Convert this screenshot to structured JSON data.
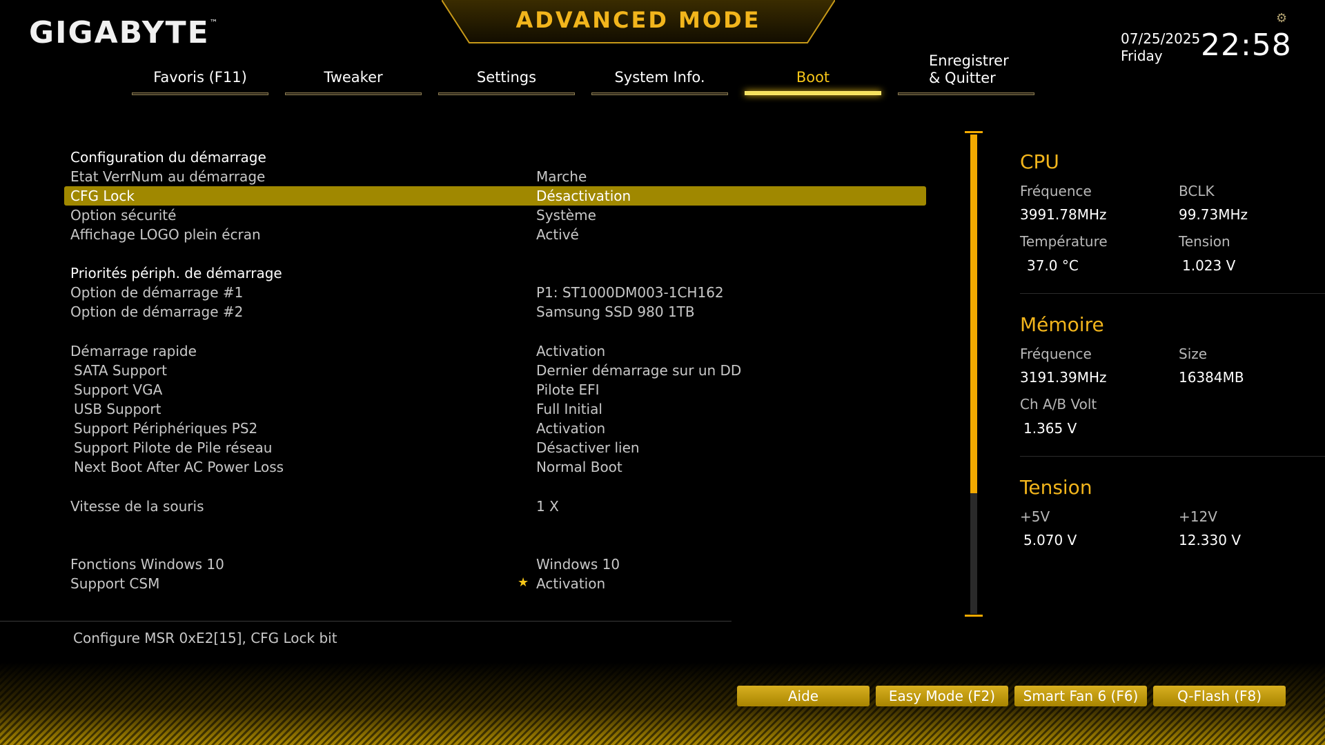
{
  "header": {
    "logo": "GIGABYTE",
    "logo_tm": "™",
    "mode_title": "ADVANCED MODE",
    "date": "07/25/2025",
    "day": "Friday",
    "time": "22:58",
    "settings_icon": "gear-icon"
  },
  "tabs": [
    {
      "label": "Favoris (F11)"
    },
    {
      "label": "Tweaker"
    },
    {
      "label": "Settings"
    },
    {
      "label": "System Info."
    },
    {
      "label": "Boot",
      "active": true
    },
    {
      "label": "Enregistrer\n& Quitter"
    }
  ],
  "sections": {
    "boot_config": "Configuration du démarrage",
    "boot_priority": "Priorités périph. de démarrage"
  },
  "settings": [
    {
      "label": "Etat VerrNum au démarrage",
      "value": "Marche"
    },
    {
      "label": "CFG Lock",
      "value": "Désactivation",
      "selected": true
    },
    {
      "label": "Option sécurité",
      "value": "Système"
    },
    {
      "label": "Affichage LOGO plein écran",
      "value": "Activé"
    },
    {
      "label": "Option de démarrage #1",
      "value": "P1: ST1000DM003-1CH162"
    },
    {
      "label": "Option de démarrage #2",
      "value": "Samsung SSD 980 1TB"
    },
    {
      "label": "Démarrage rapide",
      "value": "Activation"
    },
    {
      "label": "SATA Support",
      "value": "Dernier démarrage sur un DD"
    },
    {
      "label": "Support VGA",
      "value": "Pilote EFI"
    },
    {
      "label": "USB Support",
      "value": "Full Initial"
    },
    {
      "label": "Support Périphériques PS2",
      "value": "Activation"
    },
    {
      "label": "Support Pilote de Pile réseau",
      "value": "Désactiver lien"
    },
    {
      "label": "Next Boot After AC Power Loss",
      "value": "Normal Boot"
    },
    {
      "label": "Vitesse de la souris",
      "value": "1 X"
    },
    {
      "label": "Fonctions Windows 10",
      "value": "Windows 10"
    },
    {
      "label": "Support CSM",
      "value": "Activation",
      "modified_star": "★"
    }
  ],
  "help_text": "Configure MSR 0xE2[15], CFG Lock bit",
  "info": {
    "cpu": {
      "title": "CPU",
      "freq_label": "Fréquence",
      "freq": "3991.78MHz",
      "bclk_label": "BCLK",
      "bclk": "99.73MHz",
      "temp_label": "Température",
      "temp": "37.0 °C",
      "volt_label": "Tension",
      "volt": "1.023 V"
    },
    "memory": {
      "title": "Mémoire",
      "freq_label": "Fréquence",
      "freq": "3191.39MHz",
      "size_label": "Size",
      "size": "16384MB",
      "volt_label": "Ch A/B Volt",
      "volt": "1.365 V"
    },
    "voltage": {
      "title": "Tension",
      "v5_label": "+5V",
      "v5": "5.070 V",
      "v12_label": "+12V",
      "v12": "12.330 V"
    }
  },
  "footer_buttons": [
    {
      "label": "Aide"
    },
    {
      "label": "Easy Mode (F2)"
    },
    {
      "label": "Smart Fan 6 (F6)"
    },
    {
      "label": "Q-Flash (F8)"
    }
  ],
  "colors": {
    "accent": "#f2b51c",
    "highlight_row": "#a08800",
    "scrollbar": "#f2a900"
  }
}
